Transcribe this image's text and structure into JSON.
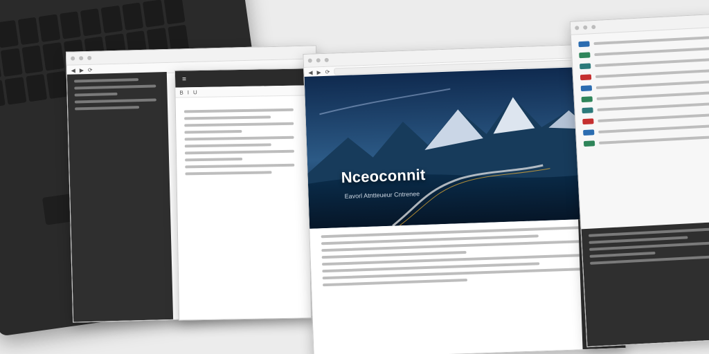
{
  "laptop": {
    "brand": ""
  },
  "windows": {
    "left_notes": {
      "title": "",
      "toolbar_hint": ""
    },
    "middle_doc": {
      "title": "",
      "heading": ""
    },
    "main_hero": {
      "hero_title": "Nceoconnit",
      "hero_subtitle": "Eavorl Atntteueur Cntrenee",
      "button": ""
    },
    "right_panel": {
      "title": ""
    }
  }
}
